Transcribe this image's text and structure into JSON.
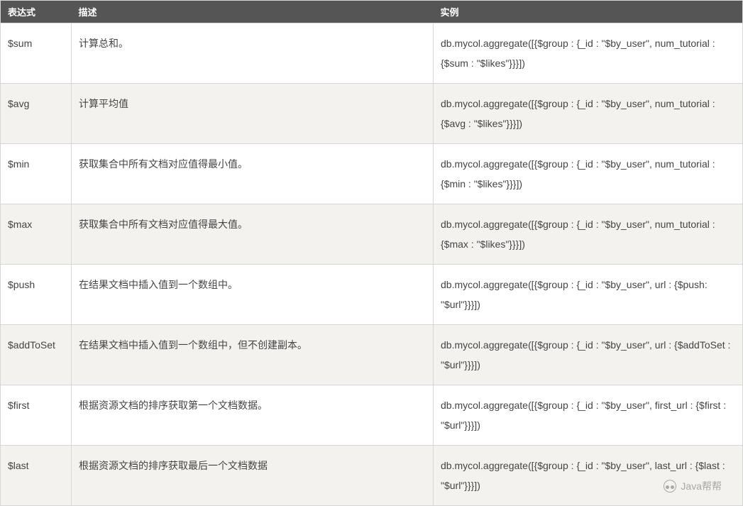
{
  "table": {
    "headers": {
      "expr": "表达式",
      "desc": "描述",
      "example": "实例"
    },
    "rows": [
      {
        "expr": "$sum",
        "desc": "计算总和。",
        "example": "db.mycol.aggregate([{$group : {_id : \"$by_user\", num_tutorial : {$sum : \"$likes\"}}}])"
      },
      {
        "expr": "$avg",
        "desc": "计算平均值",
        "example": "db.mycol.aggregate([{$group : {_id : \"$by_user\", num_tutorial : {$avg : \"$likes\"}}}])"
      },
      {
        "expr": "$min",
        "desc": "获取集合中所有文档对应值得最小值。",
        "example": "db.mycol.aggregate([{$group : {_id : \"$by_user\", num_tutorial : {$min : \"$likes\"}}}])"
      },
      {
        "expr": "$max",
        "desc": "获取集合中所有文档对应值得最大值。",
        "example": "db.mycol.aggregate([{$group : {_id : \"$by_user\", num_tutorial : {$max : \"$likes\"}}}])"
      },
      {
        "expr": "$push",
        "desc": "在结果文档中插入值到一个数组中。",
        "example": "db.mycol.aggregate([{$group : {_id : \"$by_user\", url : {$push: \"$url\"}}}])"
      },
      {
        "expr": "$addToSet",
        "desc": "在结果文档中插入值到一个数组中，但不创建副本。",
        "example": "db.mycol.aggregate([{$group : {_id : \"$by_user\", url : {$addToSet : \"$url\"}}}])"
      },
      {
        "expr": "$first",
        "desc": "根据资源文档的排序获取第一个文档数据。",
        "example": "db.mycol.aggregate([{$group : {_id : \"$by_user\", first_url : {$first : \"$url\"}}}])"
      },
      {
        "expr": "$last",
        "desc": "根据资源文档的排序获取最后一个文档数据",
        "example": "db.mycol.aggregate([{$group : {_id : \"$by_user\", last_url : {$last : \"$url\"}}}])"
      }
    ]
  },
  "watermark": "Java帮帮"
}
